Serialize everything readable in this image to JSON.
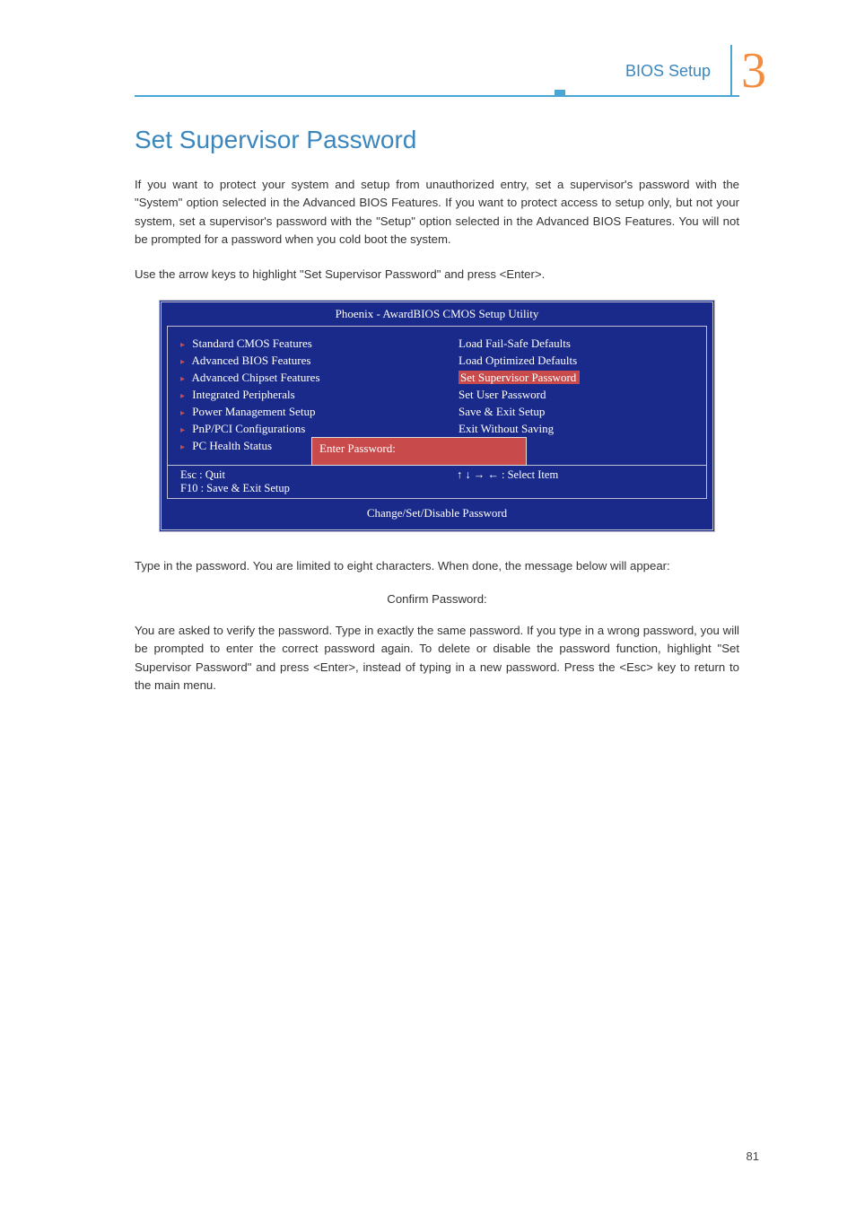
{
  "header": {
    "section_label": "BIOS Setup",
    "chapter_number": "3"
  },
  "title": "Set Supervisor Password",
  "para1": "If you want to protect your system and setup from unauthorized entry, set a supervisor's password with the \"System\" option selected in the Advanced BIOS Features. If you want to protect access to setup only, but not your system, set a supervisor's password with the \"Setup\" option selected in the Advanced BIOS Features. You will not be prompted for a password when you cold boot the system.",
  "para2": "Use the arrow keys to highlight \"Set Supervisor Password\" and press <Enter>.",
  "bios": {
    "title": "Phoenix - AwardBIOS CMOS Setup Utility",
    "left_items": [
      "Standard CMOS Features",
      "Advanced BIOS Features",
      "Advanced Chipset Features",
      "Integrated Peripherals",
      "Power Management Setup",
      "PnP/PCI Configurations",
      "PC Health Status"
    ],
    "right_items": [
      "Load Fail-Safe Defaults",
      "Load Optimized Defaults",
      "Set Supervisor Password",
      "Set User Password",
      "Save & Exit Setup",
      "Exit Without Saving"
    ],
    "highlighted_index": 2,
    "prompt": "Enter Password:",
    "footer_left_1": "Esc   :  Quit",
    "footer_left_2": "F10  :  Save & Exit Setup",
    "footer_right": "↑ ↓ → ← : Select Item",
    "footer_bottom": "Change/Set/Disable Password"
  },
  "para3": "Type in the password. You are limited to eight characters. When done, the message below will appear:",
  "confirm_label": "Confirm Password:",
  "para4": "You are asked to verify the password. Type in exactly the same password. If you type in a wrong password, you will be prompted to enter the correct password again. To delete or disable the password function, highlight \"Set Supervisor Password\" and press <Enter>, instead of typing in a new password. Press the <Esc> key to return to the main menu.",
  "page_number": "81"
}
